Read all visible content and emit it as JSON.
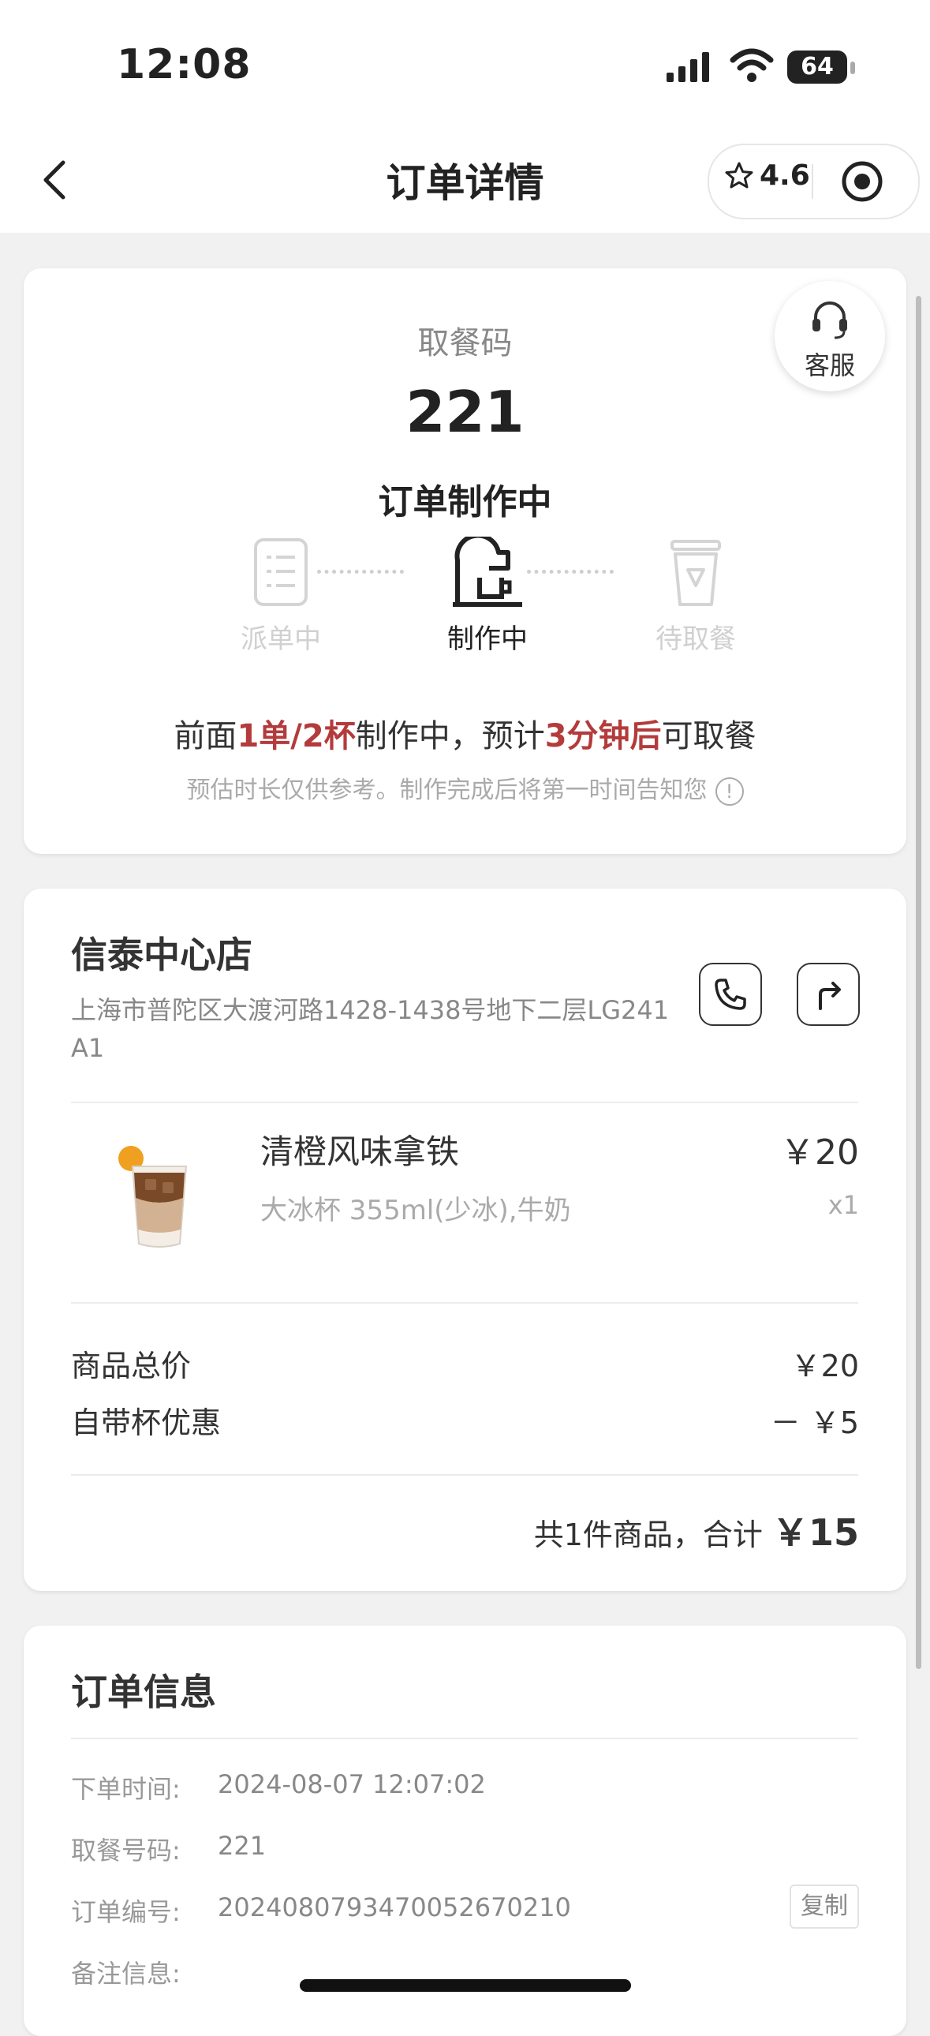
{
  "status_bar": {
    "time": "12:08",
    "battery": "64"
  },
  "nav": {
    "title": "订单详情",
    "rating": "4.6"
  },
  "pickup": {
    "label": "取餐码",
    "code": "221",
    "status": "订单制作中",
    "service_label": "客服",
    "steps": [
      {
        "label": "派单中",
        "active": false
      },
      {
        "label": "制作中",
        "active": true
      },
      {
        "label": "待取餐",
        "active": false
      }
    ],
    "queue": {
      "prefix": "前面",
      "count": "1单/2杯",
      "middle": "制作中，预计",
      "eta": "3分钟后",
      "suffix": "可取餐"
    },
    "note": "预估时长仅供参考。制作完成后将第一时间告知您"
  },
  "store": {
    "name": "信泰中心店",
    "address": "上海市普陀区大渡河路1428-1438号地下二层LG241A1"
  },
  "product": {
    "name": "清橙风味拿铁",
    "spec": "大冰杯 355ml(少冰),牛奶",
    "price": "￥20",
    "qty": "x1"
  },
  "summary": {
    "subtotal_label": "商品总价",
    "subtotal": "￥20",
    "discount_label": "自带杯优惠",
    "discount": "－ ￥5",
    "total_prefix": "共1件商品，合计",
    "total": "￥15"
  },
  "order_info": {
    "title": "订单信息",
    "time_label": "下单时间:",
    "time": "2024-08-07 12:07:02",
    "code_label": "取餐号码:",
    "code": "221",
    "number_label": "订单编号:",
    "number": "20240807934700526702​10",
    "copy_label": "复制",
    "remark_label": "备注信息:"
  },
  "colors": {
    "accent_red": "#b43b3b",
    "text_dark": "#222222",
    "muted": "#aaaaaa",
    "background": "#f1f1f1"
  }
}
